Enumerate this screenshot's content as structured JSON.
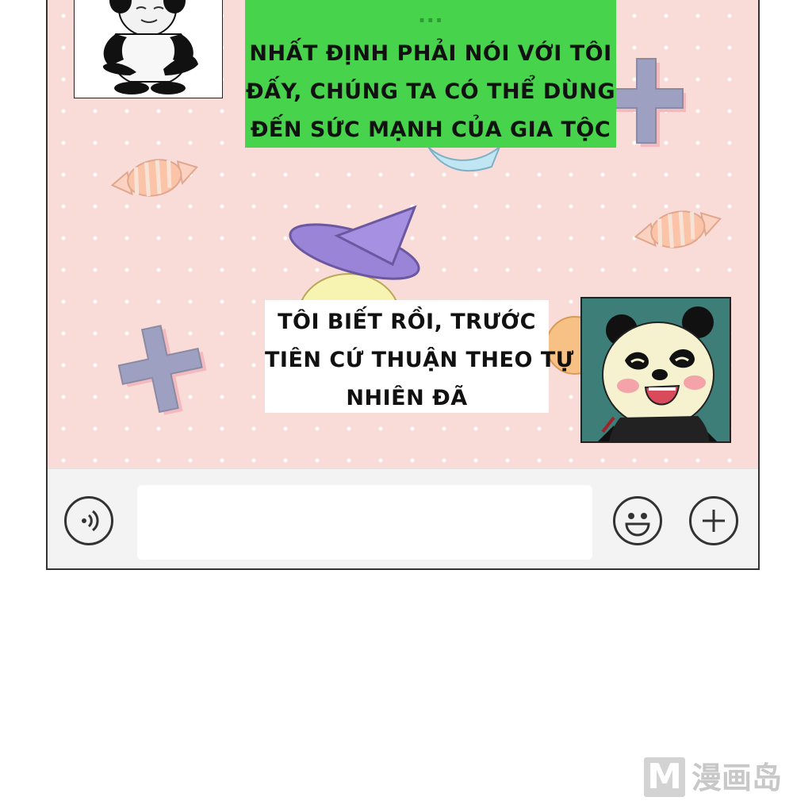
{
  "chat": {
    "messages": [
      {
        "side": "right",
        "bubble_color": "#47d34c",
        "lines": [
          "...",
          "NHẤT ĐỊNH PHẢI NÓI VỚI TÔI",
          "ĐẤY, CHÚNG TA CÓ THỂ DÙNG",
          "ĐẾN SỨC MẠNH CỦA GIA TỘC"
        ],
        "avatar": "panda-meme-avatar"
      },
      {
        "side": "left",
        "bubble_color": "#ffffff",
        "lines": [
          "TÔI BIẾT RỒI, TRƯỚC",
          "TIÊN CỨ THUẬN THEO TỰ",
          "NHIÊN ĐÃ"
        ],
        "avatar": "laughing-panda-avatar"
      }
    ],
    "background": {
      "color": "#f9dcd8",
      "decorations": [
        "candy-icon",
        "cross-icon",
        "witch-hat-icon"
      ]
    }
  },
  "input_bar": {
    "voice_icon": "voice-icon",
    "text_value": "",
    "emoji_icon": "emoji-icon",
    "add_icon": "plus-icon"
  },
  "watermark": {
    "logo_letter": "M",
    "text": "漫画岛"
  }
}
